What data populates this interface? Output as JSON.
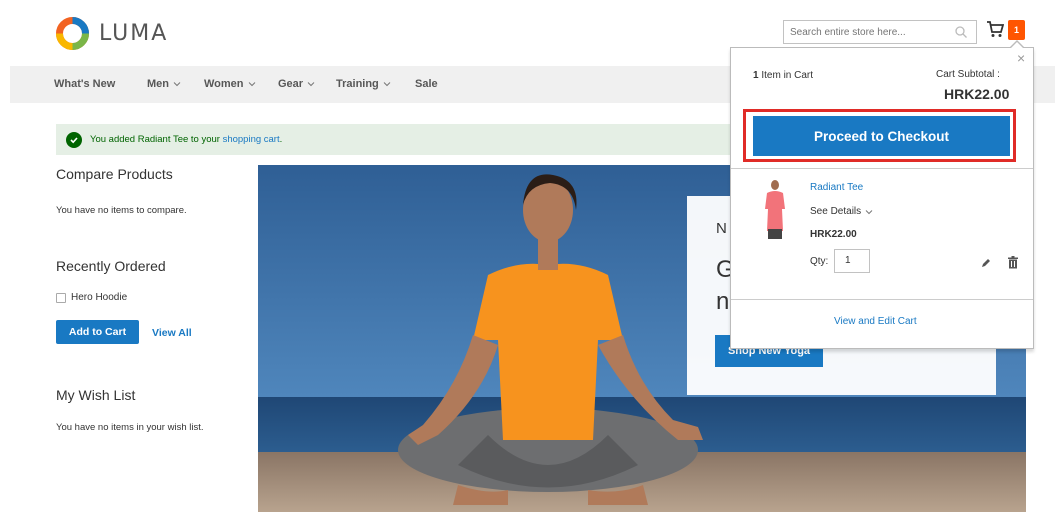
{
  "header": {
    "logo_text": "LUMA",
    "search_placeholder": "Search entire store here...",
    "cart_icon": "cart-icon",
    "cart_counter": "1"
  },
  "nav": {
    "items": [
      {
        "label": "What's New",
        "has_dropdown": false
      },
      {
        "label": "Men",
        "has_dropdown": true
      },
      {
        "label": "Women",
        "has_dropdown": true
      },
      {
        "label": "Gear",
        "has_dropdown": true
      },
      {
        "label": "Training",
        "has_dropdown": true
      },
      {
        "label": "Sale",
        "has_dropdown": false
      }
    ]
  },
  "message": {
    "text": "You added Radiant Tee to your ",
    "link": "shopping cart",
    "suffix": "."
  },
  "sidebar": {
    "compare_title": "Compare Products",
    "compare_empty": "You have no items to compare.",
    "recent_title": "Recently Ordered",
    "recent_items": [
      "Hero Hoodie"
    ],
    "add_to_cart": "Add to Cart",
    "view_all": "View All",
    "wishlist_title": "My Wish List",
    "wishlist_empty": "You have no items in your wish list."
  },
  "hero": {
    "promo_line1": "N",
    "promo_line2": "G",
    "promo_line3": "n",
    "cta": "Shop New Yoga"
  },
  "minicart": {
    "count_number": "1",
    "count_text": " Item in Cart",
    "subtotal_label": "Cart Subtotal :",
    "subtotal_price": "HRK22.00",
    "checkout_label": "Proceed to Checkout",
    "item": {
      "name": "Radiant Tee",
      "see_details": "See Details",
      "price": "HRK22.00",
      "qty_label": "Qty:",
      "qty": "1"
    },
    "view_edit": "View and Edit Cart"
  },
  "colors": {
    "accent": "#1979c3",
    "counter": "#ff5501",
    "highlight": "#e02b27",
    "success_bg": "#e5efe5",
    "success_text": "#006400"
  }
}
